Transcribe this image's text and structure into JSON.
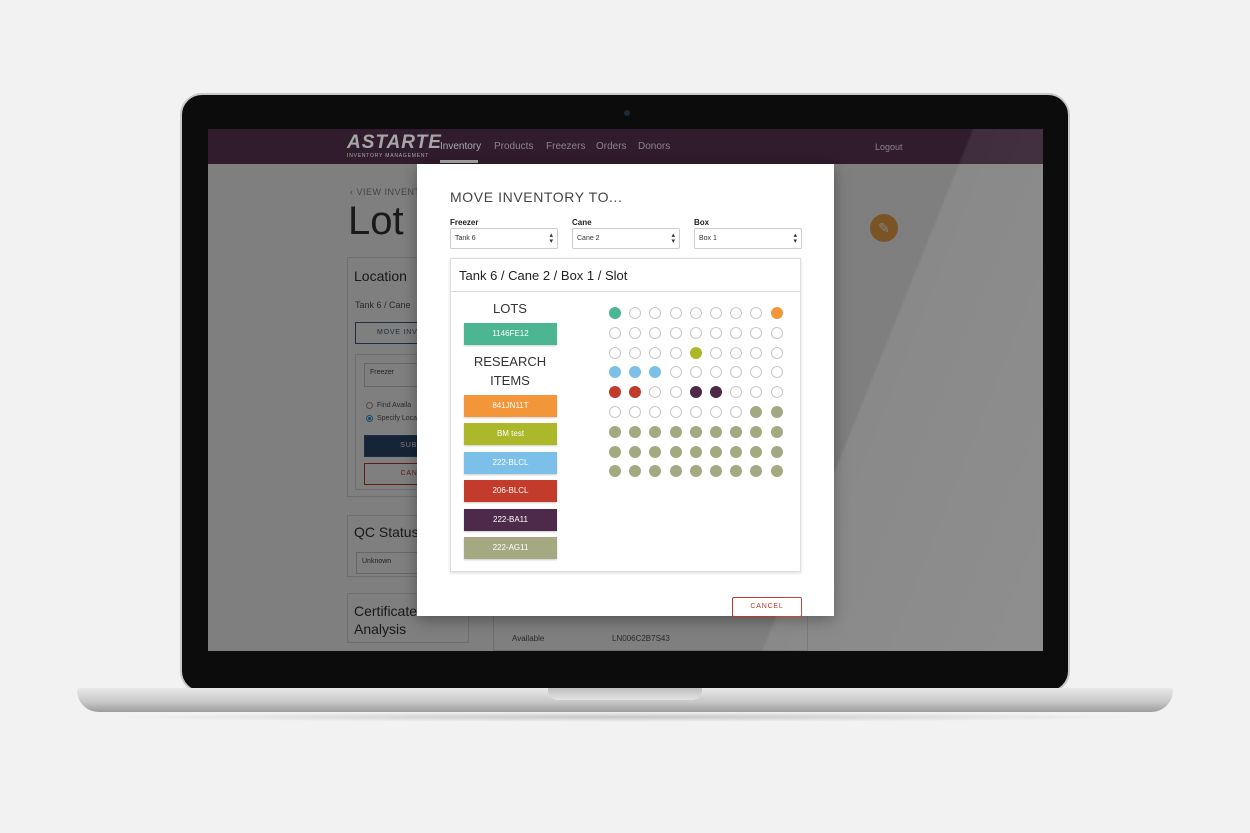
{
  "app": {
    "logo": "ASTARTE",
    "logo_sub": "INVENTORY MANAGEMENT",
    "nav": [
      "Inventory",
      "Products",
      "Freezers",
      "Orders",
      "Donors"
    ],
    "logout": "Logout"
  },
  "background": {
    "back_link": "‹ VIEW INVENT",
    "title": "Lot",
    "location_title": "Location",
    "location_path": "Tank 6 / Cane",
    "move_button": "MOVE INVE",
    "freezer_field": "Freezer",
    "radio_find": "Find Availa",
    "radio_specify": "Specify Loca",
    "submit": "SUBM",
    "cancel": "CANC",
    "qc_title": "QC Status",
    "qc_value": "Unknown",
    "cert_title": "Certificate\nAnalysis",
    "available_label": "Available",
    "available_value": "LN006C2B7S43"
  },
  "modal": {
    "title": "MOVE INVENTORY TO...",
    "selects": [
      {
        "label": "Freezer",
        "value": "Tank 6"
      },
      {
        "label": "Cane",
        "value": "Cane 2"
      },
      {
        "label": "Box",
        "value": "Box 1"
      }
    ],
    "slot_path": "Tank 6 / Cane 2 / Box 1 / Slot",
    "lots_heading": "LOTS",
    "lots": [
      {
        "label": "1146FE12",
        "color": "#4cb591"
      }
    ],
    "research_heading": "RESEARCH ITEMS",
    "research_items": [
      {
        "label": "841JN11T",
        "color": "#f39639"
      },
      {
        "label": "BM test",
        "color": "#aab82a"
      },
      {
        "label": "222-BLCL",
        "color": "#7cc0ea"
      },
      {
        "label": "206-BLCL",
        "color": "#c23b2b"
      },
      {
        "label": "222-BA11",
        "color": "#4e2a4a"
      },
      {
        "label": "222-AG11",
        "color": "#a5a982"
      }
    ],
    "grid_legend": {
      ".": "empty",
      "L": "1146FE12",
      "O": "841JN11T",
      "B": "BM test",
      "C": "222-BLCL",
      "R": "206-BLCL",
      "P": "222-BA11",
      "G": "222-AG11"
    },
    "grid": [
      "L.......O",
      ".........",
      "....B....",
      "CCC......",
      "RR..PP...",
      ".......GG",
      "GGGGGGGGG",
      "GGGGGGGGG",
      "GGGGGGGGG"
    ],
    "cancel": "CANCEL"
  },
  "colors": {
    "nav_bg": "#4a2c44",
    "fab": "#f6a94a",
    "cancel": "#c0392b"
  }
}
